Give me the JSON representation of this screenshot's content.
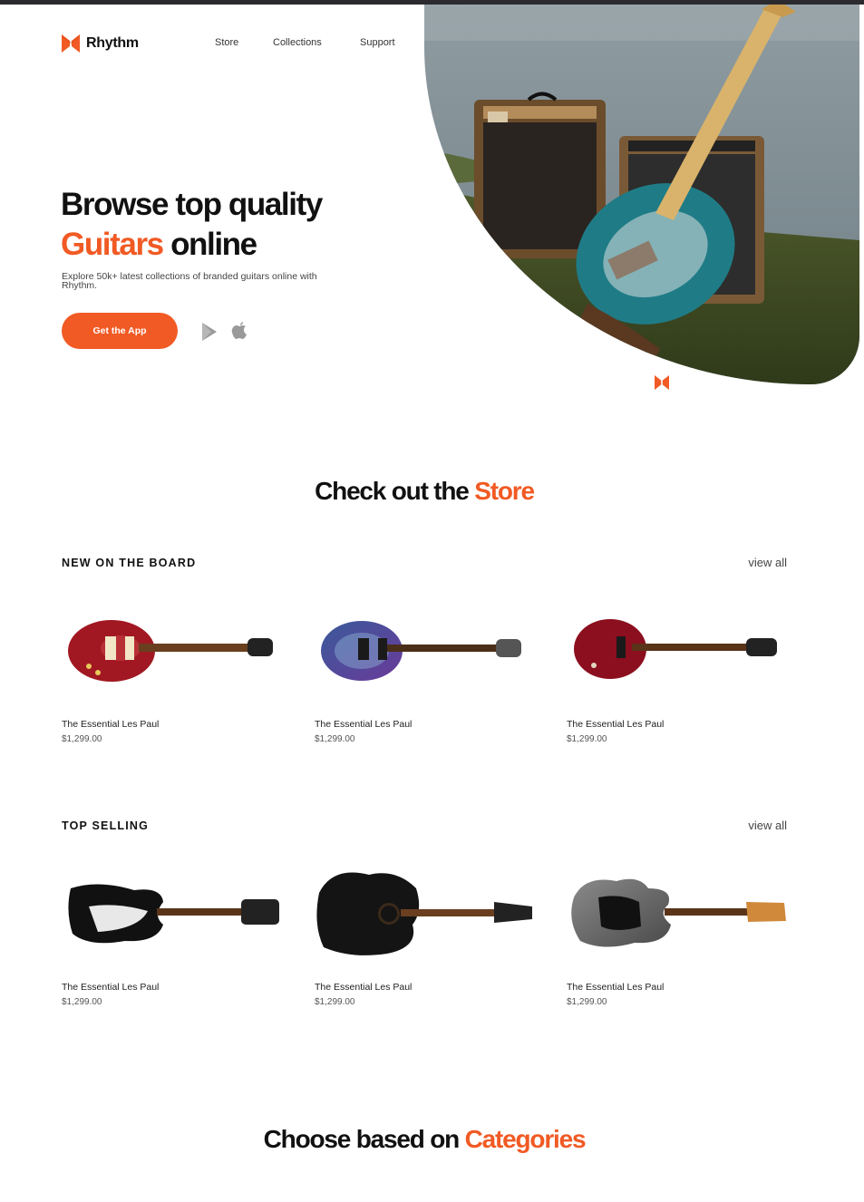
{
  "brand": {
    "name": "Rhythm",
    "accent_color": "#f15a24"
  },
  "nav": [
    "Store",
    "Collections",
    "Support"
  ],
  "hero": {
    "title_line1": "Browse top quality",
    "title_accent": "Guitars",
    "title_rest": "online",
    "subtitle": "Explore 50k+ latest collections of branded guitars online with Rhythm.",
    "cta_label": "Get the App",
    "store_icons": [
      "google-play-icon",
      "apple-icon"
    ]
  },
  "store_section": {
    "title_plain": "Check out the",
    "title_accent": "Store"
  },
  "groups": [
    {
      "label": "NEW ON THE BOARD",
      "view_all": "view all",
      "products": [
        {
          "name": "The Essential Les Paul",
          "price": "$1,299.00"
        },
        {
          "name": "The Essential Les Paul",
          "price": "$1,299.00"
        },
        {
          "name": "The Essential Les Paul",
          "price": "$1,299.00"
        }
      ]
    },
    {
      "label": "TOP SELLING",
      "view_all": "view all",
      "products": [
        {
          "name": "The Essential Les Paul",
          "price": "$1,299.00"
        },
        {
          "name": "The Essential Les Paul",
          "price": "$1,299.00"
        },
        {
          "name": "The Essential Les Paul",
          "price": "$1,299.00"
        }
      ]
    }
  ],
  "categories_section": {
    "title_plain": "Choose based on",
    "title_accent": "Categories"
  }
}
